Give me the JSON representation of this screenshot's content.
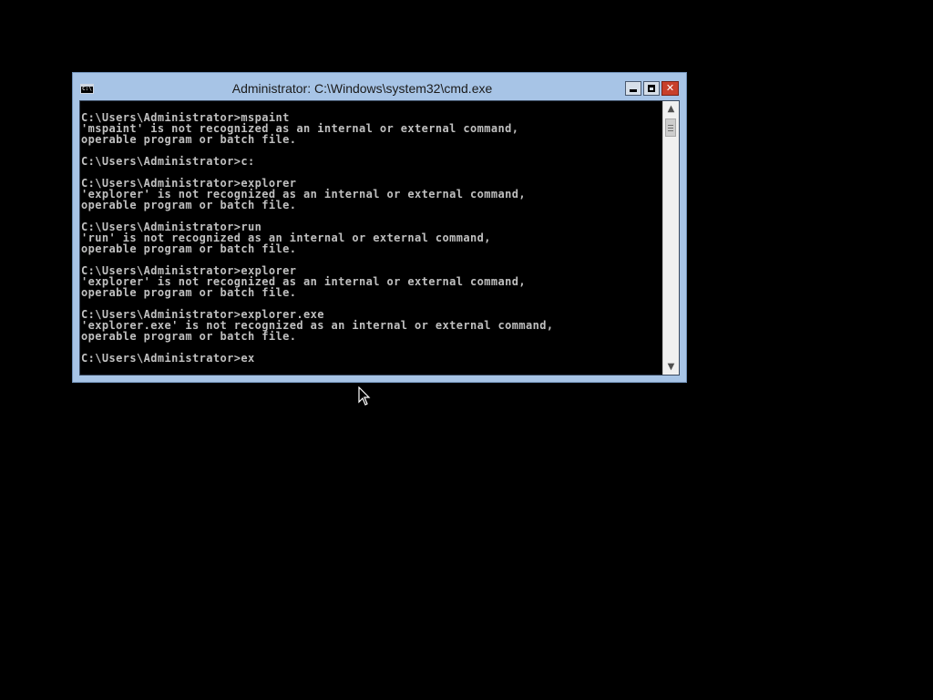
{
  "window": {
    "title": "Administrator: C:\\Windows\\system32\\cmd.exe",
    "icon": "cmd-icon",
    "icon_text": "C:\\.",
    "controls": {
      "minimize": "minimize",
      "maximize": "maximize",
      "close": "✕"
    }
  },
  "console": {
    "text_color": "#c0c0c0",
    "background": "#000000",
    "lines": [
      "C:\\Users\\Administrator>mspaint",
      "'mspaint' is not recognized as an internal or external command,",
      "operable program or batch file.",
      "",
      "C:\\Users\\Administrator>c:",
      "",
      "C:\\Users\\Administrator>explorer",
      "'explorer' is not recognized as an internal or external command,",
      "operable program or batch file.",
      "",
      "C:\\Users\\Administrator>run",
      "'run' is not recognized as an internal or external command,",
      "operable program or batch file.",
      "",
      "C:\\Users\\Administrator>explorer",
      "'explorer' is not recognized as an internal or external command,",
      "operable program or batch file.",
      "",
      "C:\\Users\\Administrator>explorer.exe",
      "'explorer.exe' is not recognized as an internal or external command,",
      "operable program or batch file.",
      "",
      "C:\\Users\\Administrator>ex"
    ]
  },
  "scrollbar": {
    "up_arrow": "▲",
    "down_arrow": "▼",
    "position": 0
  },
  "colors": {
    "desktop": "#000000",
    "window_frame": "#a7c4e6",
    "close_button": "#c8402b"
  }
}
